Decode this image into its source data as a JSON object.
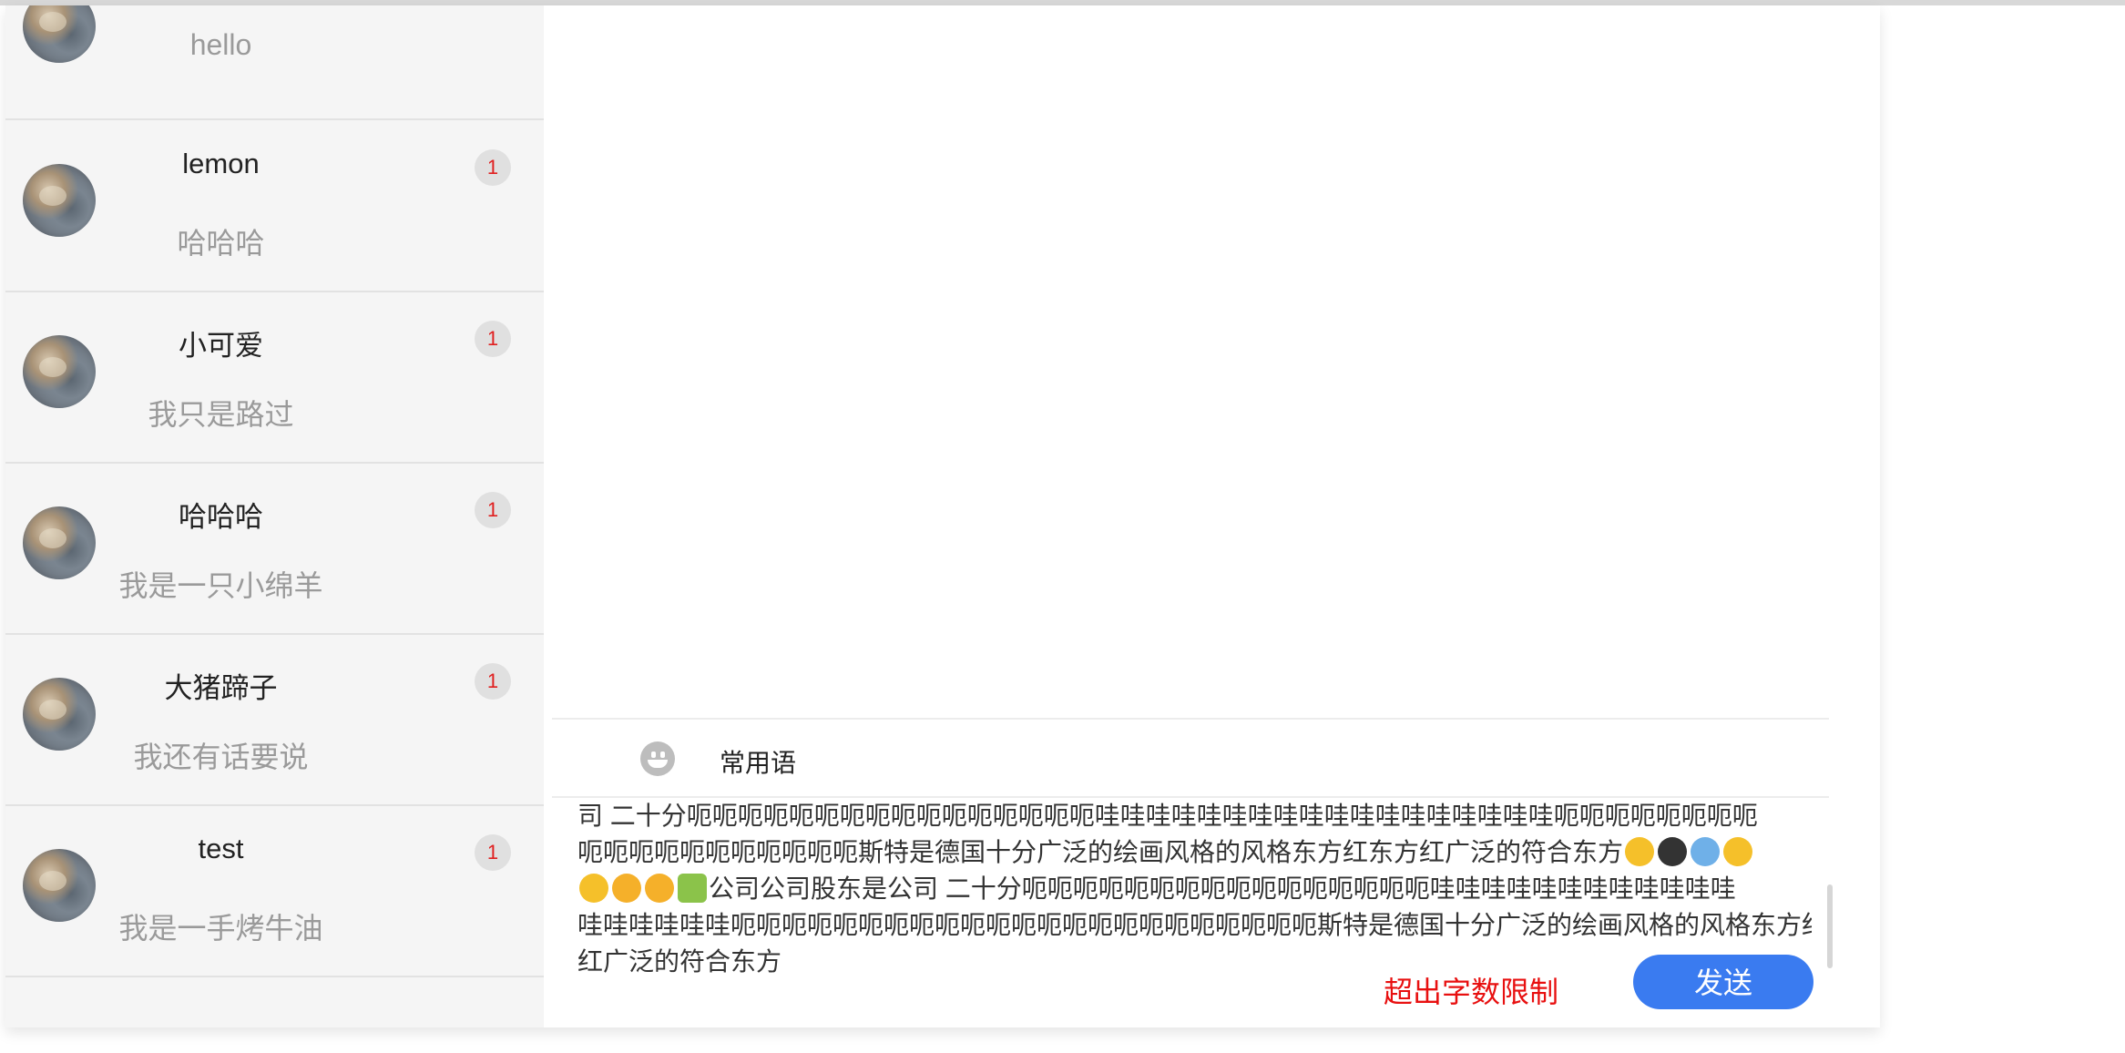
{
  "contacts": [
    {
      "name": "",
      "message": "hello",
      "badge": ""
    },
    {
      "name": "lemon",
      "message": "哈哈哈",
      "badge": "1"
    },
    {
      "name": "小可爱",
      "message": "我只是路过",
      "badge": "1"
    },
    {
      "name": "哈哈哈",
      "message": "我是一只小绵羊",
      "badge": "1"
    },
    {
      "name": "大猪蹄子",
      "message": "我还有话要说",
      "badge": "1"
    },
    {
      "name": "test",
      "message": "我是一手烤牛油",
      "badge": "1"
    }
  ],
  "toolbar": {
    "emoji_icon": "emoji-icon",
    "common_phrases_label": "常用语"
  },
  "editor": {
    "lines": [
      "司 二十分呃呃呃呃呃呃呃呃呃呃呃呃呃呃呃呃哇哇哇哇哇哇哇哇哇哇哇哇哇哇哇哇哇哇呃呃呃呃呃呃呃呃",
      "呃呃呃呃呃呃呃呃呃呃呃斯特是德国十分广泛的绘画风格的风格东方红东方红广泛的符合东方",
      "公司公司股东是公司 二十分呃呃呃呃呃呃呃呃呃呃呃呃呃呃呃呃哇哇哇哇哇哇哇哇哇哇哇哇",
      "哇哇哇哇哇哇呃呃呃呃呃呃呃呃呃呃呃呃呃呃呃呃呃呃呃呃呃呃呃斯特是德国十分广泛的绘画风格的风格东方红东方",
      "红广泛的符合东方"
    ]
  },
  "status": {
    "limit_warning": "超出字数限制"
  },
  "actions": {
    "send_label": "发送"
  },
  "colors": {
    "accent": "#3a7bf0",
    "warning": "#e81010",
    "badge_text": "#e02020",
    "sidebar_bg": "#f5f5f5"
  }
}
